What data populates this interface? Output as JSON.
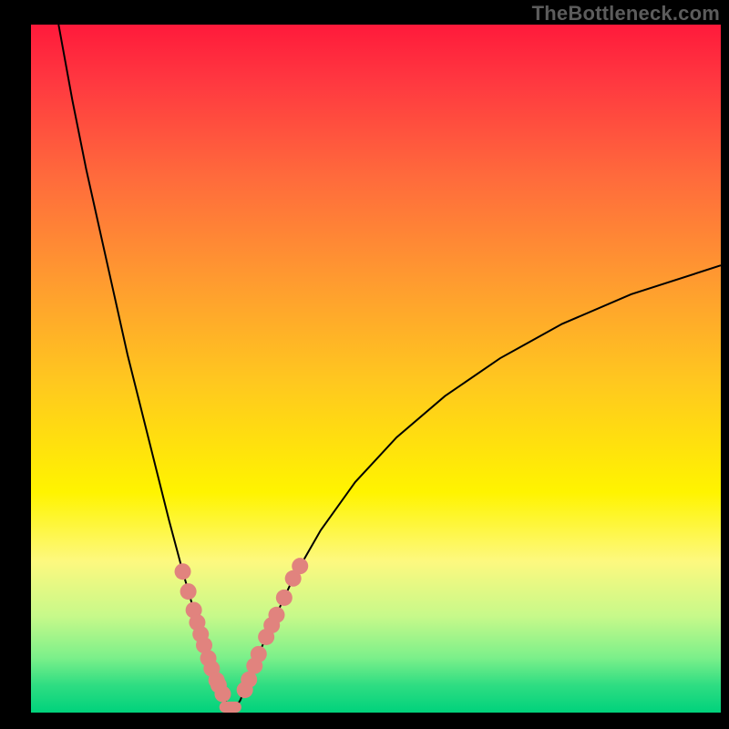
{
  "watermark": "TheBottleneck.com",
  "chart_data": {
    "type": "line",
    "title": "",
    "xlabel": "",
    "ylabel": "",
    "xlim": [
      0,
      100
    ],
    "ylim": [
      0,
      100
    ],
    "background_gradient": {
      "top": "#ff1a3b",
      "mid_upper": "#ff9a30",
      "mid": "#fff400",
      "mid_lower": "#7cf08a",
      "bottom": "#00d27c"
    },
    "series": [
      {
        "name": "curve",
        "color": "#000000",
        "stroke_width": 2,
        "x": [
          4,
          6,
          8,
          10,
          12,
          14,
          16,
          18,
          20,
          22,
          24,
          25.5,
          27,
          28.2,
          29,
          30.3,
          31.5,
          33,
          35,
          38,
          42,
          47,
          53,
          60,
          68,
          77,
          87,
          100
        ],
        "values": [
          100,
          89,
          79,
          70,
          61,
          52,
          44,
          36,
          28,
          20.5,
          13.5,
          8.5,
          4.5,
          1.7,
          0,
          1.7,
          4.5,
          8.5,
          13,
          19.5,
          26.5,
          33.5,
          40,
          46,
          51.5,
          56.5,
          60.8,
          65
        ]
      }
    ],
    "markers": {
      "name": "dots",
      "color": "#e1837e",
      "radius": 9,
      "points": [
        {
          "x": 22.0,
          "y": 20.5
        },
        {
          "x": 22.8,
          "y": 17.6
        },
        {
          "x": 23.6,
          "y": 14.9
        },
        {
          "x": 24.1,
          "y": 13.1
        },
        {
          "x": 24.6,
          "y": 11.4
        },
        {
          "x": 25.1,
          "y": 9.8
        },
        {
          "x": 25.7,
          "y": 7.9
        },
        {
          "x": 26.2,
          "y": 6.4
        },
        {
          "x": 26.9,
          "y": 4.7
        },
        {
          "x": 27.2,
          "y": 4.0
        },
        {
          "x": 27.8,
          "y": 2.7
        },
        {
          "x": 31.0,
          "y": 3.3
        },
        {
          "x": 31.6,
          "y": 4.8
        },
        {
          "x": 32.4,
          "y": 6.8
        },
        {
          "x": 33.0,
          "y": 8.5
        },
        {
          "x": 34.1,
          "y": 11.0
        },
        {
          "x": 34.9,
          "y": 12.7
        },
        {
          "x": 35.6,
          "y": 14.2
        },
        {
          "x": 36.7,
          "y": 16.7
        },
        {
          "x": 38.0,
          "y": 19.5
        },
        {
          "x": 39.0,
          "y": 21.3
        }
      ]
    },
    "bottom_bar": {
      "color": "#e1837e",
      "x_start": 27.3,
      "x_end": 30.5,
      "height": 1.6
    }
  }
}
